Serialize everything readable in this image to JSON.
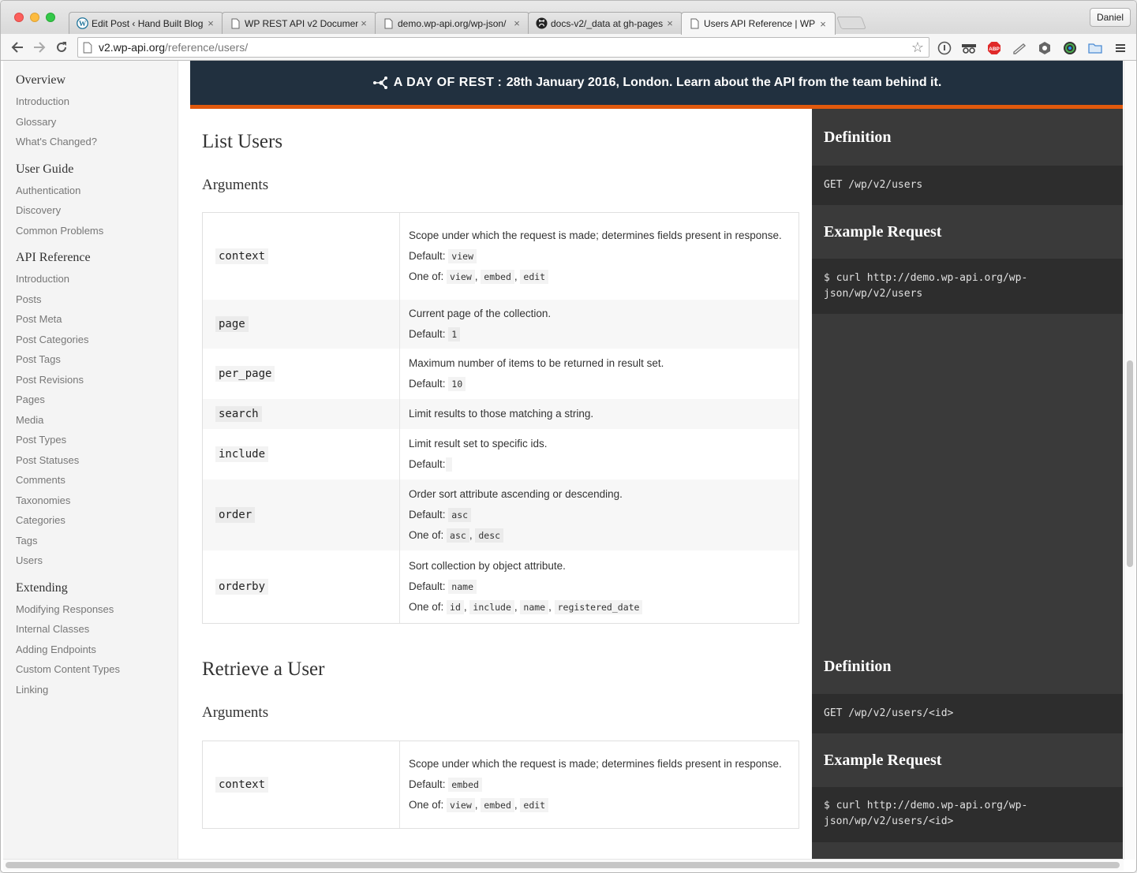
{
  "browser": {
    "tabs": [
      {
        "title": "Edit Post ‹ Hand Built Blog",
        "icon": "wordpress-icon"
      },
      {
        "title": "WP REST API v2 Documen",
        "icon": "page-icon"
      },
      {
        "title": "demo.wp-api.org/wp-json/",
        "icon": "page-icon"
      },
      {
        "title": "docs-v2/_data at gh-pages",
        "icon": "github-icon"
      },
      {
        "title": "Users API Reference | WP",
        "icon": "page-icon"
      }
    ],
    "user_label": "Daniel",
    "url_host": "v2.wp-api.org",
    "url_path": "/reference/users/"
  },
  "sidebar": {
    "groups": [
      {
        "heading": "Overview",
        "items": [
          "Introduction",
          "Glossary",
          "What's Changed?"
        ]
      },
      {
        "heading": "User Guide",
        "items": [
          "Authentication",
          "Discovery",
          "Common Problems"
        ]
      },
      {
        "heading": "API Reference",
        "items": [
          "Introduction",
          "Posts",
          "Post Meta",
          "Post Categories",
          "Post Tags",
          "Post Revisions",
          "Pages",
          "Media",
          "Post Types",
          "Post Statuses",
          "Comments",
          "Taxonomies",
          "Categories",
          "Tags",
          "Users"
        ]
      },
      {
        "heading": "Extending",
        "items": [
          "Modifying Responses",
          "Internal Classes",
          "Adding Endpoints",
          "Custom Content Types",
          "Linking"
        ]
      }
    ]
  },
  "banner": {
    "brand": "A DAY OF REST",
    "separator": ":",
    "text": "28th January 2016, London. Learn about the API from the team behind it."
  },
  "labels": {
    "default": "Default:",
    "one_of": "One of:"
  },
  "sections": [
    {
      "title": "List Users",
      "args_title": "Arguments",
      "args": [
        {
          "name": "context",
          "description": "Scope under which the request is made; determines fields present in response.",
          "default": "view",
          "one_of": [
            "view",
            "embed",
            "edit"
          ]
        },
        {
          "name": "page",
          "description": "Current page of the collection.",
          "default": "1"
        },
        {
          "name": "per_page",
          "description": "Maximum number of items to be returned in result set.",
          "default": "10"
        },
        {
          "name": "search",
          "description": "Limit results to those matching a string."
        },
        {
          "name": "include",
          "description": "Limit result set to specific ids.",
          "default": ""
        },
        {
          "name": "order",
          "description": "Order sort attribute ascending or descending.",
          "default": "asc",
          "one_of": [
            "asc",
            "desc"
          ]
        },
        {
          "name": "orderby",
          "description": "Sort collection by object attribute.",
          "default": "name",
          "one_of": [
            "id",
            "include",
            "name",
            "registered_date"
          ]
        }
      ],
      "definition_title": "Definition",
      "definition": "GET /wp/v2/users",
      "example_title": "Example Request",
      "example_lines": [
        "$ curl http://demo.wp-api.org/wp-",
        "json/wp/v2/users"
      ]
    },
    {
      "title": "Retrieve a User",
      "args_title": "Arguments",
      "args": [
        {
          "name": "context",
          "description": "Scope under which the request is made; determines fields present in response.",
          "default": "embed",
          "one_of": [
            "view",
            "embed",
            "edit"
          ]
        }
      ],
      "definition_title": "Definition",
      "definition": "GET /wp/v2/users/<id>",
      "example_title": "Example Request",
      "example_lines": [
        "$ curl http://demo.wp-api.org/wp-",
        "json/wp/v2/users/<id>"
      ]
    }
  ],
  "colors": {
    "banner_bg": "#21303f",
    "banner_accent": "#e1590d",
    "rail_bg": "#3a3a3a",
    "rail_code_bg": "#2d2d2d"
  }
}
